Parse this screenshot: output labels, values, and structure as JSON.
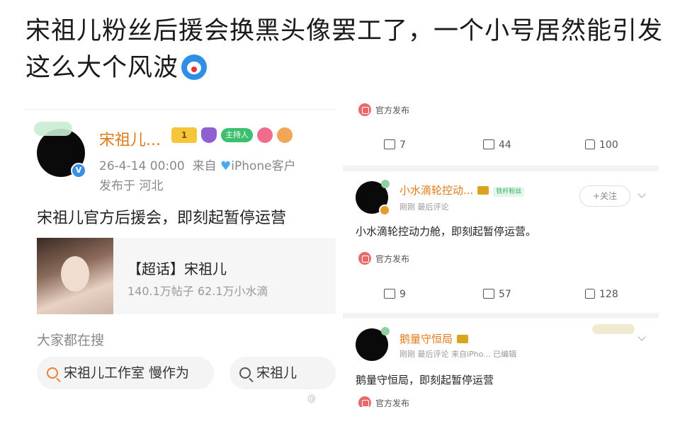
{
  "headline": "宋祖儿粉丝后援会换黑头像罢工了，一个小号居然能引发这么大个风波",
  "left": {
    "name": "宋祖儿...",
    "level_badge": "1",
    "host_badge": "主持人",
    "time": "26-4-14 00:00",
    "source_prefix": "来自",
    "source": "iPhone客户",
    "location": "发布于 河北",
    "text": "宋祖儿官方后援会，即刻起暂停运营",
    "topic_title": "【超话】宋祖儿",
    "topic_stats": "140.1万帖子 62.1万小水滴",
    "search_header": "大家都在搜",
    "search_items": [
      "宋祖儿工作室 慢作为",
      "宋祖儿"
    ],
    "watermark": "@"
  },
  "right": {
    "card1": {
      "official": "官方发布",
      "reposts": "7",
      "comments": "44",
      "likes": "100"
    },
    "card2": {
      "name": "小水滴轮控动...",
      "tag": "铁杆粉丝",
      "meta": "刚刚 最后评论",
      "follow": "+关注",
      "text": "小水滴轮控动力舱，即刻起暂停运营。",
      "official": "官方发布",
      "reposts": "9",
      "comments": "57",
      "likes": "128"
    },
    "card3": {
      "name": "鹅量守恒局",
      "meta": "刚刚 最后评论 来自iPho... 已编辑",
      "text": "鹅量守恒局，即刻起暂停运营",
      "official": "官方发布"
    }
  }
}
